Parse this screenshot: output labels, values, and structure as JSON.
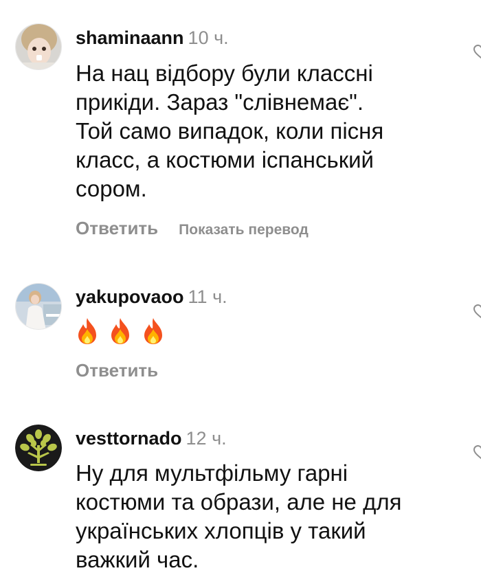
{
  "comments": [
    {
      "username": "shaminaann",
      "time": "10 ч.",
      "text": "На нац відбору були классні\nприкіди. Зараз \"слівнемає\".\nТой само випадок, коли пісня\nкласс, а костюми іспанський\nсором.",
      "reply_label": "Ответить",
      "translate_label": "Показать перевод",
      "avatar_icon": "avatar-photo-girl"
    },
    {
      "username": "yakupovaoo",
      "time": "11 ч.",
      "emoji_icons": [
        "fire-icon",
        "fire-icon",
        "fire-icon"
      ],
      "reply_label": "Ответить",
      "avatar_icon": "avatar-photo-woman-white-dress"
    },
    {
      "username": "vesttornado",
      "time": "12 ч.",
      "text": "Ну для мультфільму гарні\nкостюми та образи, але не для\nукраїнських хлопців у такий\nважкий час.",
      "avatar_icon": "tree-logo"
    }
  ],
  "colors": {
    "muted": "#8e8e8e",
    "text": "#111111",
    "tree_green": "#b9c64a"
  }
}
